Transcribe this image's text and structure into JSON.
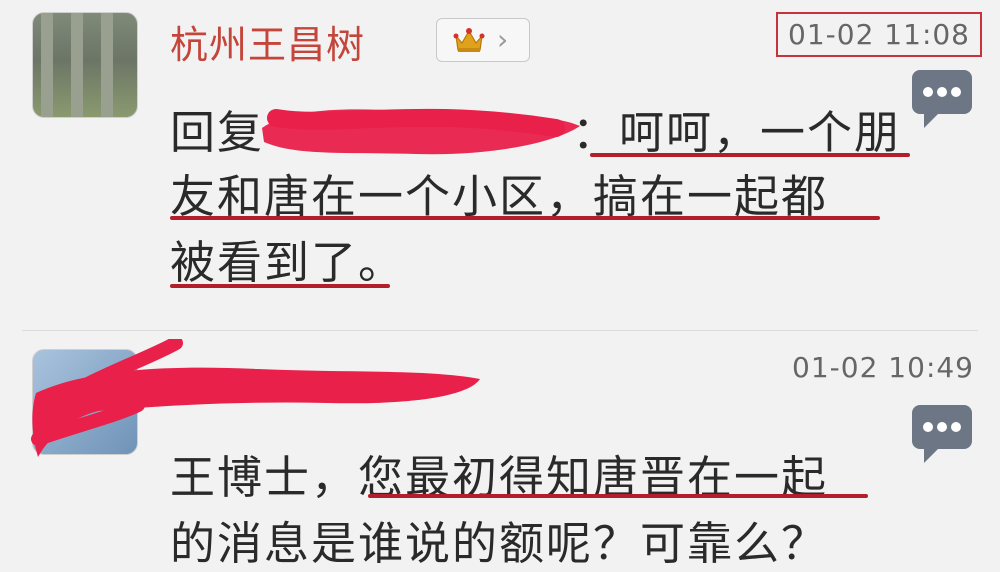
{
  "comments": [
    {
      "username": "杭州王昌树",
      "timestamp": "01-02 11:08",
      "body_lines": [
        "回复",
        "：呵呵，一个朋",
        "友和唐在一个小区，搞在一起都",
        "被看到了。"
      ]
    },
    {
      "username": "",
      "timestamp": "01-02 10:49",
      "body_lines": [
        "王博士，您最初得知唐晋在一起",
        "的消息是谁说的额呢？可靠么？"
      ]
    }
  ],
  "icons": {
    "vip_badge": "crown-icon",
    "more_actions": "speech-bubble-more-icon"
  },
  "colors": {
    "username": "#c4453a",
    "underline": "#b21f2b",
    "highlight_box": "#c8323a",
    "redaction": "#e8204a"
  }
}
